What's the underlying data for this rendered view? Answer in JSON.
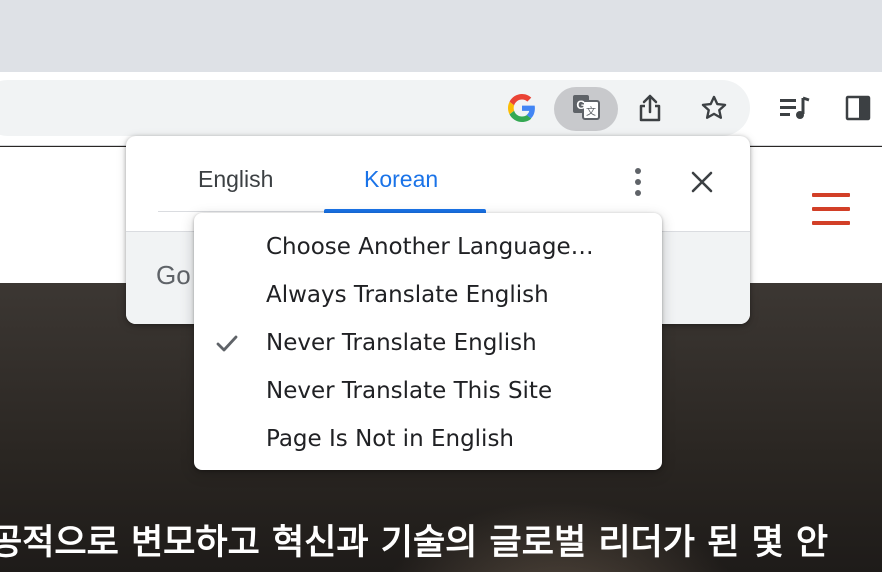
{
  "browser": {
    "icons": [
      "google-icon",
      "translate-icon",
      "share-icon",
      "bookmark-star-icon",
      "reading-list-icon",
      "side-panel-icon"
    ]
  },
  "page": {
    "caption": "공적으로 변모하고 혁신과 기술의 글로벌 리더가 된 몇 안",
    "accent_color": "#d23f27"
  },
  "translate_bubble": {
    "tabs": [
      {
        "label": "English",
        "selected": false
      },
      {
        "label": "Korean",
        "selected": true
      }
    ],
    "footer_text": "Go",
    "accent_color": "#1a73e8"
  },
  "options_menu": {
    "items": [
      {
        "label": "Choose Another Language…",
        "checked": false
      },
      {
        "label": "Always Translate English",
        "checked": false
      },
      {
        "label": "Never Translate English",
        "checked": true
      },
      {
        "label": "Never Translate This Site",
        "checked": false
      },
      {
        "label": "Page Is Not in English",
        "checked": false
      }
    ]
  }
}
